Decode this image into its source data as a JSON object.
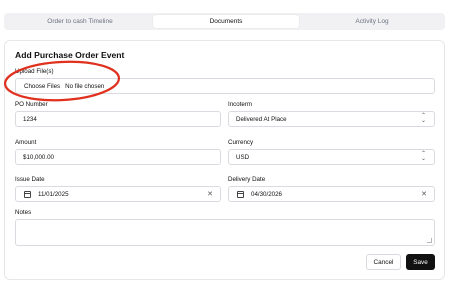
{
  "tabs": [
    {
      "label": "Order to cash Timeline",
      "active": false
    },
    {
      "label": "Documents",
      "active": true
    },
    {
      "label": "Activity Log",
      "active": false
    }
  ],
  "form": {
    "title": "Add Purchase Order Event",
    "upload": {
      "label": "Upload File(s)",
      "button": "Choose Files",
      "status": "No file chosen"
    },
    "po_number": {
      "label": "PO Number",
      "value": "1234"
    },
    "incoterm": {
      "label": "Incoterm",
      "value": "Delivered At Place"
    },
    "amount": {
      "label": "Amount",
      "value": "$10,000.00"
    },
    "currency": {
      "label": "Currency",
      "value": "USD"
    },
    "issue_date": {
      "label": "Issue Date",
      "value": "11/01/2025"
    },
    "delivery_date": {
      "label": "Delivery Date",
      "value": "04/30/2026"
    },
    "notes": {
      "label": "Notes",
      "value": ""
    }
  },
  "actions": {
    "cancel": "Cancel",
    "save": "Save"
  },
  "annotation_color": "#e0301e",
  "save_button_color": "#111111"
}
